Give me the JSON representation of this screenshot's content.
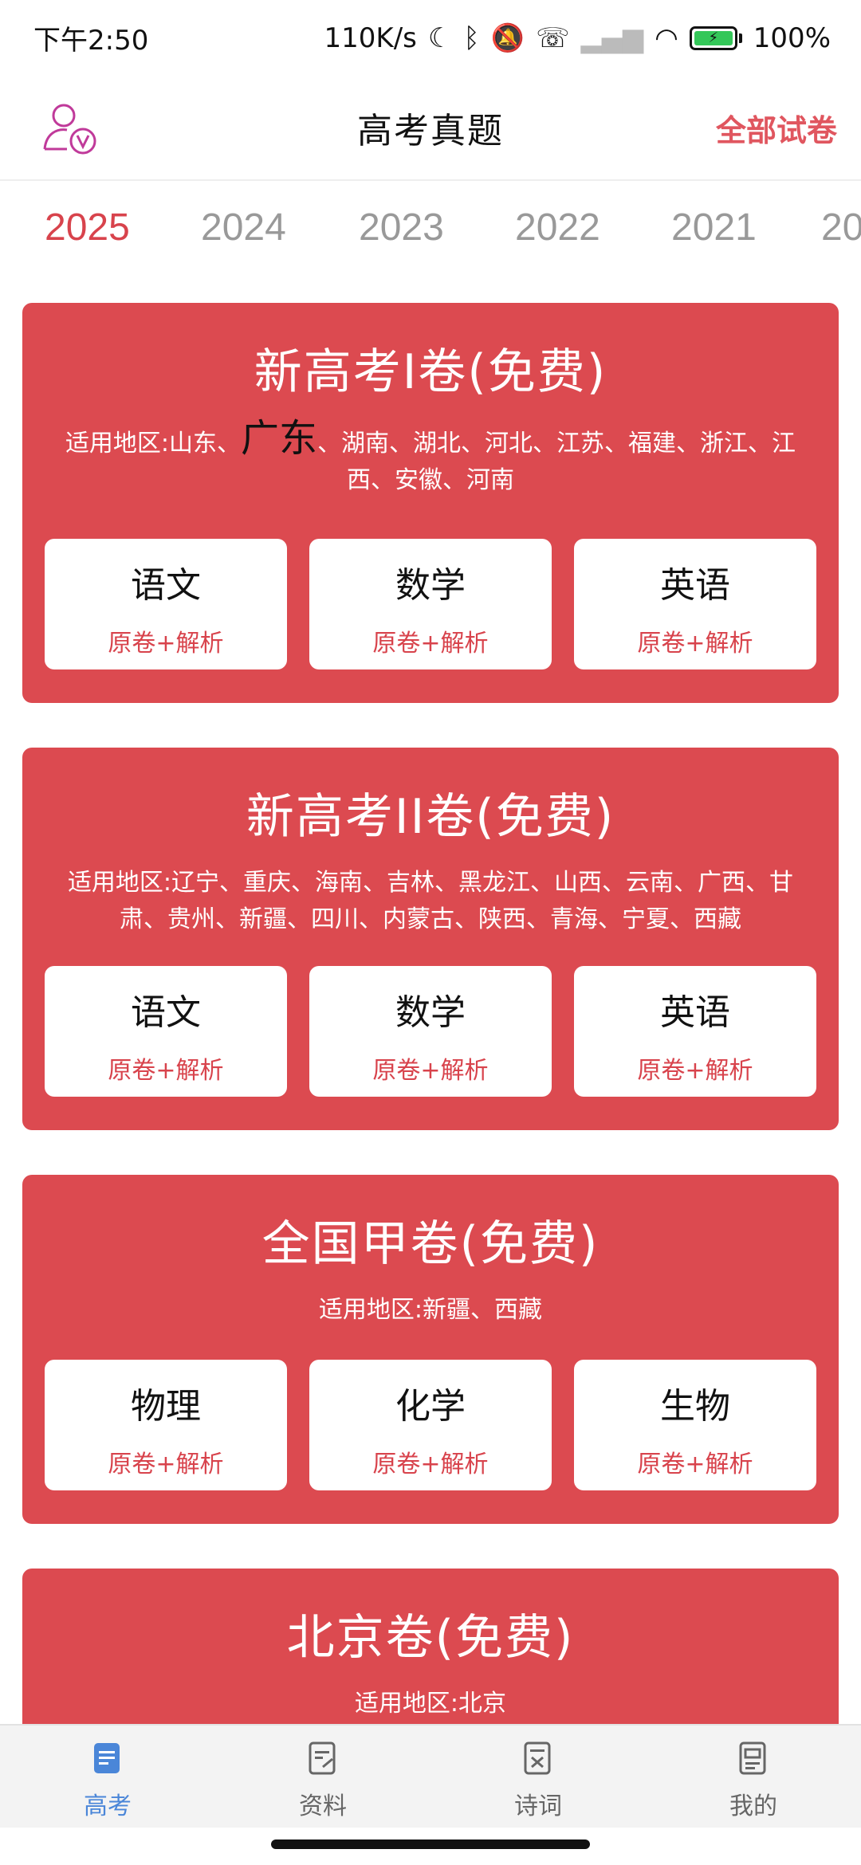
{
  "status": {
    "time": "下午2:50",
    "speed": "110K/s",
    "battery": "100%"
  },
  "header": {
    "title": "高考真题",
    "all_papers": "全部试卷"
  },
  "years": [
    "2025",
    "2024",
    "2023",
    "2022",
    "2021",
    "20"
  ],
  "cards": [
    {
      "title": "新高考I卷(免费)",
      "region_prefix": "适用地区:山东、",
      "region_highlight": "广东",
      "region_rest": "、湖南、湖北、河北、江苏、福建、浙江、江西、安徽、河南",
      "subjects": [
        {
          "name": "语文",
          "link": "原卷+解析"
        },
        {
          "name": "数学",
          "link": "原卷+解析"
        },
        {
          "name": "英语",
          "link": "原卷+解析"
        }
      ]
    },
    {
      "title": "新高考II卷(免费)",
      "region": "适用地区:辽宁、重庆、海南、吉林、黑龙江、山西、云南、广西、甘肃、贵州、新疆、四川、内蒙古、陕西、青海、宁夏、西藏",
      "subjects": [
        {
          "name": "语文",
          "link": "原卷+解析"
        },
        {
          "name": "数学",
          "link": "原卷+解析"
        },
        {
          "name": "英语",
          "link": "原卷+解析"
        }
      ]
    },
    {
      "title": "全国甲卷(免费)",
      "region": "适用地区:新疆、西藏",
      "subjects": [
        {
          "name": "物理",
          "link": "原卷+解析"
        },
        {
          "name": "化学",
          "link": "原卷+解析"
        },
        {
          "name": "生物",
          "link": "原卷+解析"
        }
      ]
    },
    {
      "title": "北京卷(免费)",
      "region": "适用地区:北京"
    }
  ],
  "nav": [
    {
      "label": "高考",
      "icon": "exam-doc-icon"
    },
    {
      "label": "资料",
      "icon": "materials-icon"
    },
    {
      "label": "诗词",
      "icon": "poetry-icon"
    },
    {
      "label": "我的",
      "icon": "profile-doc-icon"
    }
  ],
  "colors": {
    "accent": "#dc4a50",
    "active_year": "#d8434c",
    "active_nav": "#4a86d8"
  }
}
